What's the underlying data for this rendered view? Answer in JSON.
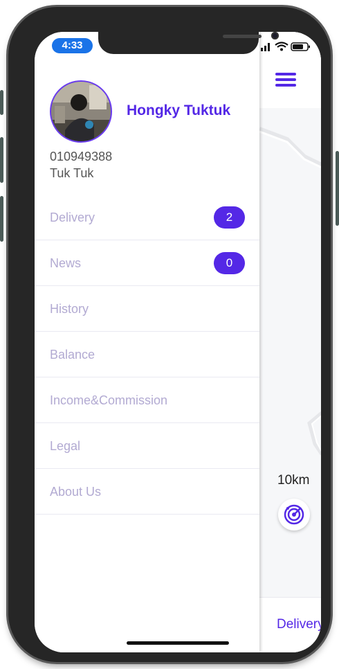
{
  "status_bar": {
    "time": "4:33"
  },
  "profile": {
    "name": "Hongky Tuktuk",
    "phone": "010949388",
    "vehicle": "Tuk Tuk"
  },
  "menu": [
    {
      "label": "Delivery",
      "badge": "2"
    },
    {
      "label": "News",
      "badge": "0"
    },
    {
      "label": "History"
    },
    {
      "label": "Balance"
    },
    {
      "label": "Income&Commission"
    },
    {
      "label": "Legal"
    },
    {
      "label": "About Us"
    }
  ],
  "map": {
    "radius_label": "10km",
    "bottom_tab": "Delivery"
  },
  "colors": {
    "accent": "#5428e6",
    "menu_text": "#b2aad2",
    "time_pill": "#1a73e8"
  },
  "icons": [
    "hamburger-menu-icon",
    "radar-icon",
    "signal-icon",
    "wifi-icon",
    "battery-icon"
  ]
}
